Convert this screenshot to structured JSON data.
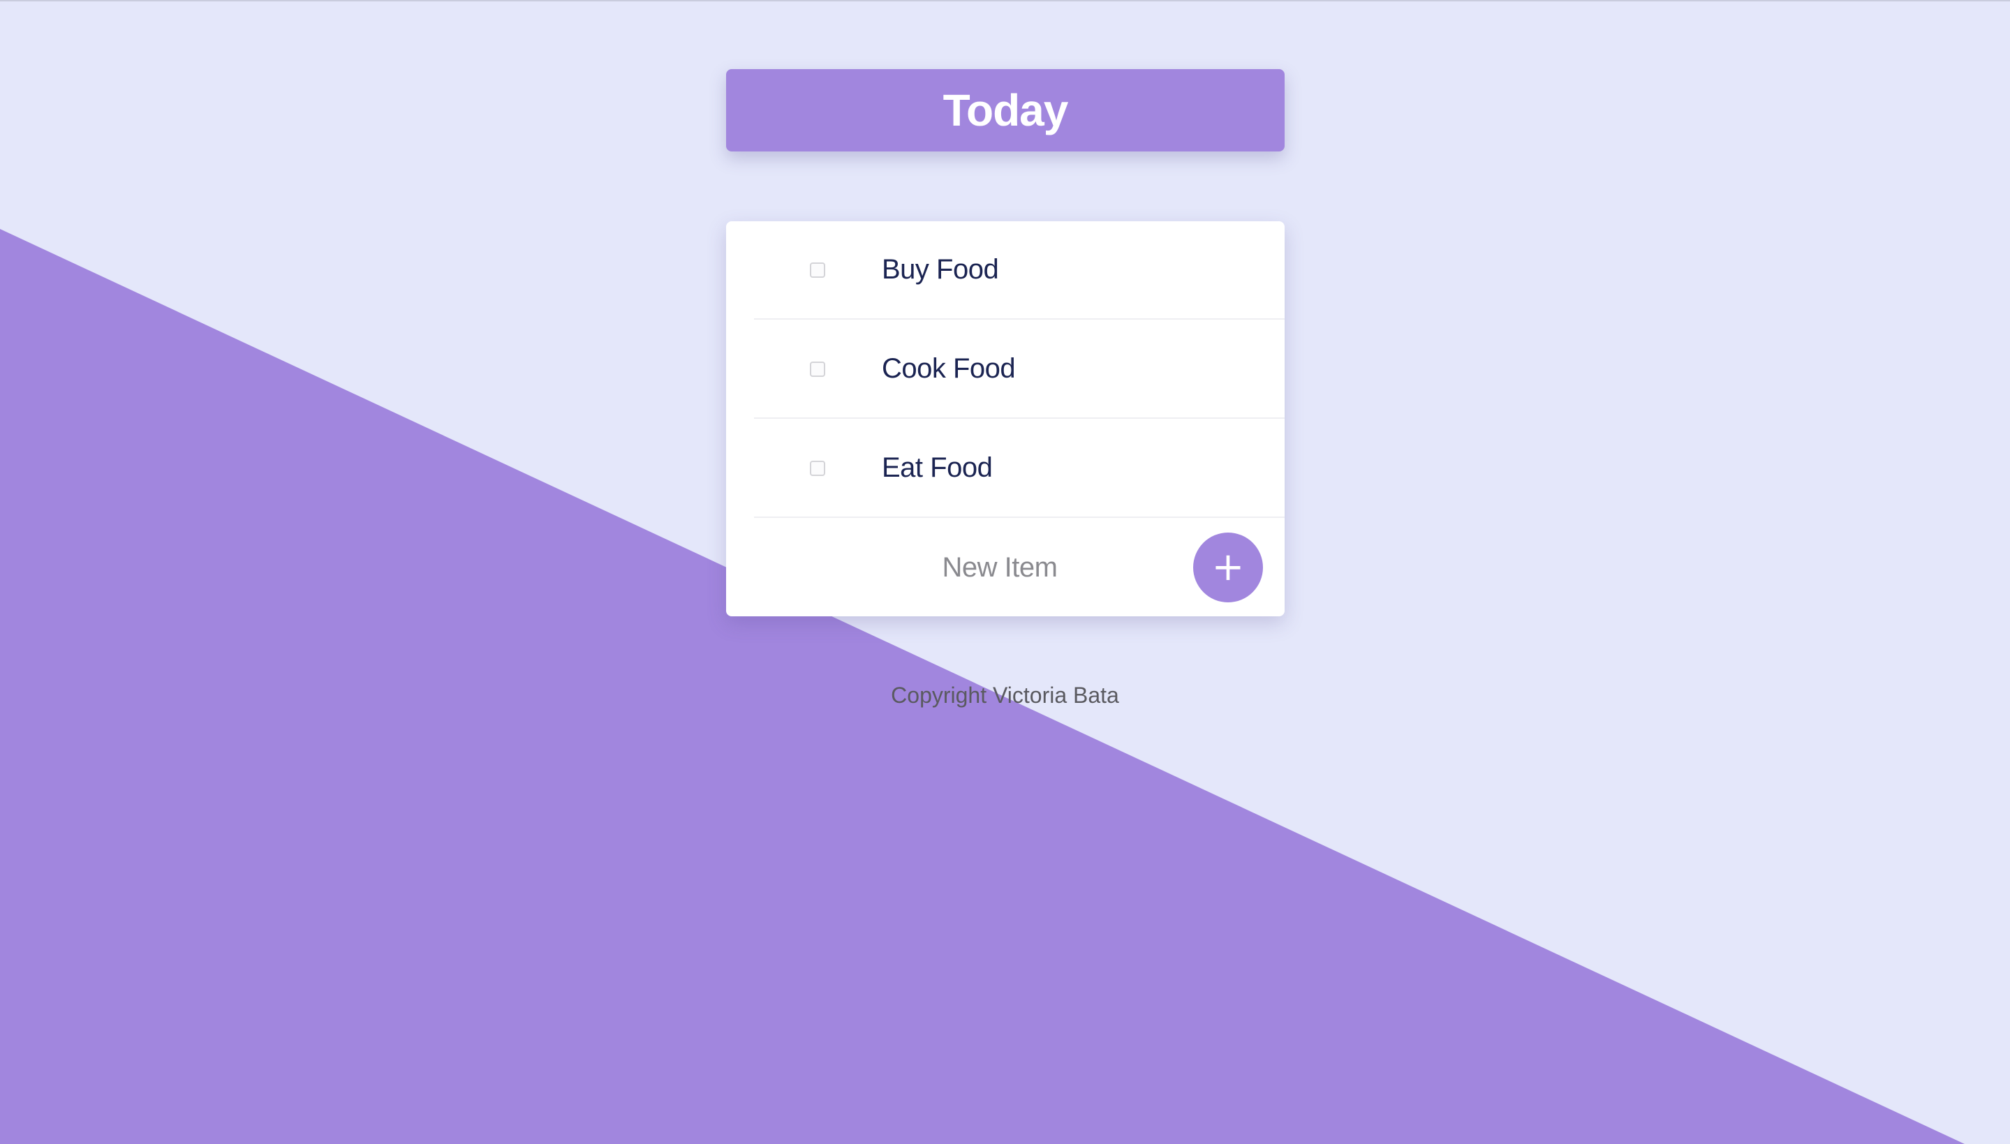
{
  "header": {
    "title": "Today"
  },
  "items": [
    {
      "label": "Buy Food",
      "checked": false
    },
    {
      "label": "Cook Food",
      "checked": false
    },
    {
      "label": "Eat Food",
      "checked": false
    }
  ],
  "new_item": {
    "placeholder": "New Item",
    "add_label": "+"
  },
  "footer": {
    "text": "Copyright Victoria Bata"
  },
  "colors": {
    "background": "#E4E7FA",
    "accent": "#A186DE",
    "card": "#FFFFFF",
    "item_text": "#1B2452"
  }
}
